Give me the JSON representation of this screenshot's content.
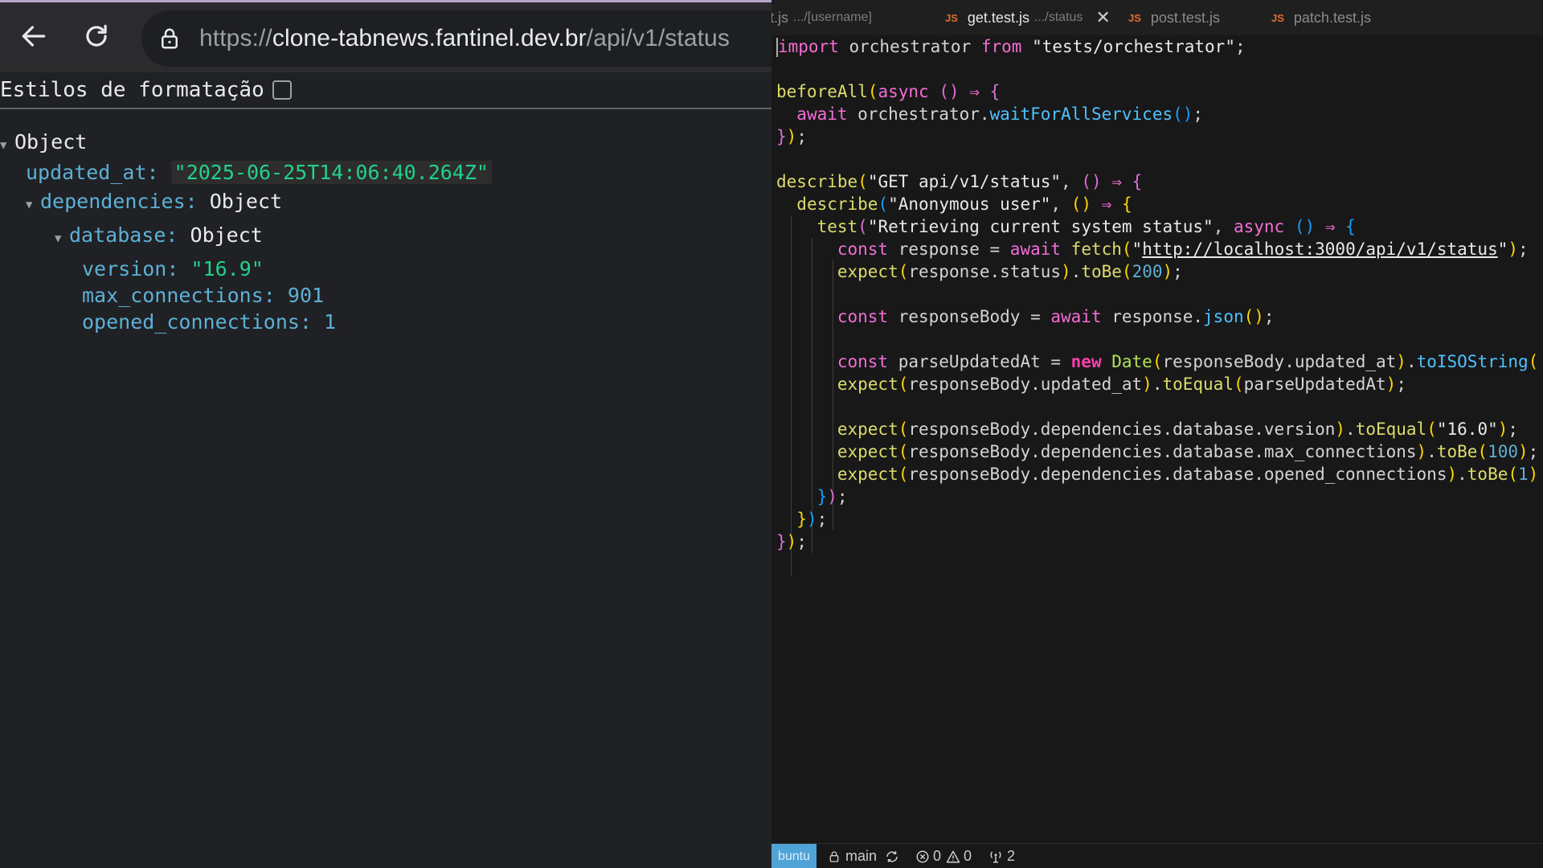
{
  "browser": {
    "url_scheme": "https://",
    "url_host": "clone-tabnews.fantinel.dev.br",
    "url_path": "/api/v1/status",
    "pretty_print_label": "Estilos de formatação",
    "pretty_print_checked": false
  },
  "json": {
    "root_label": "Object",
    "updated_at_key": "updated_at:",
    "updated_at_value": "\"2025-06-25T14:06:40.264Z\"",
    "dependencies_key": "dependencies:",
    "dependencies_value": "Object",
    "database_key": "database:",
    "database_value": "Object",
    "version_key": "version:",
    "version_value": "\"16.9\"",
    "max_connections_key": "max_connections:",
    "max_connections_value": "901",
    "opened_connections_key": "opened_connections:",
    "opened_connections_value": "1"
  },
  "editor": {
    "tabs": [
      {
        "name": "t.js",
        "path": ".../[username]"
      },
      {
        "name": "get.test.js",
        "path": ".../status"
      },
      {
        "name": "post.test.js",
        "path": ""
      },
      {
        "name": "patch.test.js",
        "path": ""
      }
    ],
    "js_badge": "JS",
    "close_glyph": "✕"
  },
  "status_bar": {
    "remote": "buntu",
    "branch": "main",
    "errors": "0",
    "warnings": "0",
    "ports": "2"
  }
}
